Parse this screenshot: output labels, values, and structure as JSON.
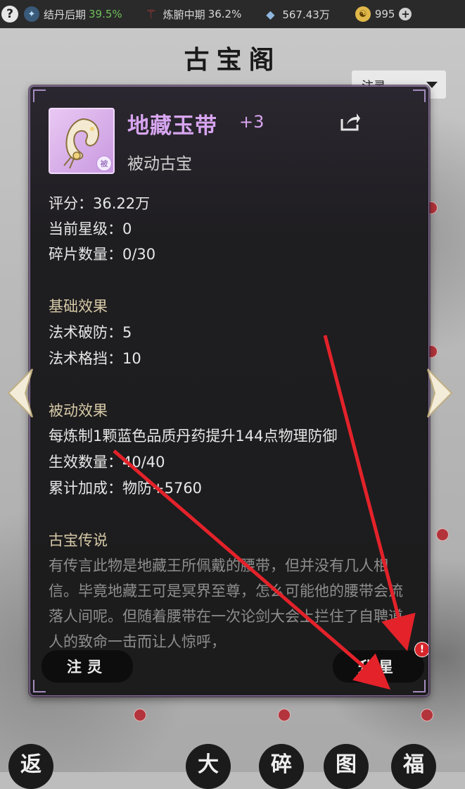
{
  "statusbar": {
    "help": "?",
    "realm_label": "结丹后期",
    "realm_percent": "39.5%",
    "body_label": "炼腑中期",
    "body_percent": "36.2%",
    "spirit_stones": "567.43万",
    "gold": "995",
    "plus": "+"
  },
  "page": {
    "title": "古宝阁",
    "sort_dropdown": "注灵"
  },
  "item": {
    "name": "地藏玉带",
    "enhance": "+3",
    "type": "被动古宝",
    "badge": "被",
    "score": "评分：36.22万",
    "star_level": "当前星级：0",
    "fragments": "碎片数量：0/30",
    "basic_heading": "基础效果",
    "basic_effects": [
      "法术破防：5",
      "法术格挡：10"
    ],
    "passive_heading": "被动效果",
    "passive_desc": "每炼制1颗蓝色品质丹药提升144点物理防御",
    "active_count": "生效数量：40/40",
    "accum_bonus": "累计加成：物防+5760",
    "lore_heading": "古宝传说",
    "lore_text": "有传言此物是地藏王所佩戴的腰带，但并没有几人相信。毕竟地藏王可是冥界至尊，怎么可能他的腰带会流落人间呢。但随着腰带在一次论剑大会上拦住了自聘道人的致命一击而让人惊呼，"
  },
  "buttons": {
    "infuse": "注灵",
    "star_up": "升星",
    "alert": "!"
  },
  "bottom_nav": [
    "返",
    "大",
    "碎",
    "图",
    "福"
  ],
  "colors": {
    "item_purple": "#d7a5f0",
    "heading_gold": "#d6c9a7",
    "alert_red": "#d7262b"
  }
}
